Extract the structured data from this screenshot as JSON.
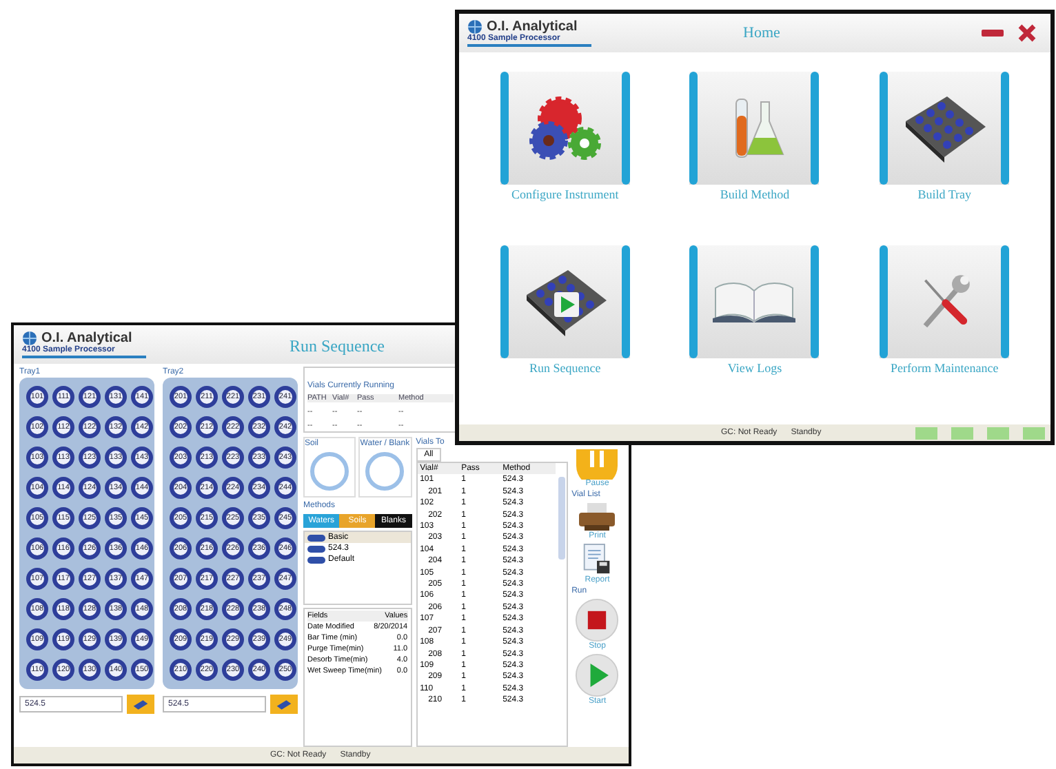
{
  "run_window": {
    "logo": "O.I. Analytical",
    "subtitle": "4100 Sample Processor",
    "title": "Run Sequence",
    "trays": [
      {
        "label": "Tray1",
        "method": "524.5",
        "vials": [
          "101",
          "111",
          "121",
          "131",
          "141",
          "102",
          "112",
          "122",
          "132",
          "142",
          "103",
          "113",
          "123",
          "133",
          "143",
          "104",
          "114",
          "124",
          "134",
          "144",
          "105",
          "115",
          "125",
          "135",
          "145",
          "106",
          "116",
          "126",
          "136",
          "146",
          "107",
          "117",
          "127",
          "137",
          "147",
          "108",
          "118",
          "128",
          "138",
          "148",
          "109",
          "119",
          "129",
          "139",
          "149",
          "110",
          "120",
          "130",
          "140",
          "150"
        ]
      },
      {
        "label": "Tray2",
        "method": "524.5",
        "vials": [
          "201",
          "211",
          "221",
          "231",
          "241",
          "202",
          "212",
          "222",
          "232",
          "242",
          "203",
          "213",
          "223",
          "233",
          "243",
          "204",
          "214",
          "224",
          "234",
          "244",
          "205",
          "215",
          "225",
          "235",
          "245",
          "206",
          "216",
          "226",
          "236",
          "246",
          "207",
          "217",
          "227",
          "237",
          "247",
          "208",
          "218",
          "228",
          "238",
          "248",
          "209",
          "219",
          "229",
          "239",
          "249",
          "210",
          "220",
          "230",
          "240",
          "250"
        ]
      }
    ],
    "running": {
      "title": "Vials Currently Running",
      "columns": [
        "PATH",
        "Vial#",
        "Pass",
        "Method"
      ],
      "rows": [
        [
          "--",
          "--",
          "--",
          "--"
        ],
        [
          "--",
          "--",
          "--",
          "--"
        ]
      ]
    },
    "soil": "Soil",
    "water": "Water / Blank",
    "methods": {
      "title": "Methods",
      "tabs": [
        {
          "label": "Waters",
          "color": "#29a3d8"
        },
        {
          "label": "Soils",
          "color": "#e8a42a"
        },
        {
          "label": "Blanks",
          "color": "#111111"
        }
      ],
      "items": [
        {
          "label": "Basic",
          "selected": true
        },
        {
          "label": "524.3",
          "selected": false
        },
        {
          "label": "Default",
          "selected": false
        }
      ]
    },
    "fields": {
      "columns": [
        "Fields",
        "Values"
      ],
      "rows": [
        [
          "Date Modified",
          "8/20/2014"
        ],
        [
          "Bar Time (min)",
          "0.0"
        ],
        [
          "Purge Time(min)",
          "11.0"
        ],
        [
          "Desorb Time(min)",
          "4.0"
        ],
        [
          "Wet Sweep Time(min)",
          "0.0"
        ]
      ]
    },
    "vials_to": {
      "label": "Vials To",
      "tab": "All",
      "columns": [
        "Vial#",
        "Pass",
        "Method"
      ],
      "rows": [
        [
          "101",
          "1",
          "524.3"
        ],
        [
          "201",
          "1",
          "524.3"
        ],
        [
          "102",
          "1",
          "524.3"
        ],
        [
          "202",
          "1",
          "524.3"
        ],
        [
          "103",
          "1",
          "524.3"
        ],
        [
          "203",
          "1",
          "524.3"
        ],
        [
          "104",
          "1",
          "524.3"
        ],
        [
          "204",
          "1",
          "524.3"
        ],
        [
          "105",
          "1",
          "524.3"
        ],
        [
          "205",
          "1",
          "524.3"
        ],
        [
          "106",
          "1",
          "524.3"
        ],
        [
          "206",
          "1",
          "524.3"
        ],
        [
          "107",
          "1",
          "524.3"
        ],
        [
          "207",
          "1",
          "524.3"
        ],
        [
          "108",
          "1",
          "524.3"
        ],
        [
          "208",
          "1",
          "524.3"
        ],
        [
          "109",
          "1",
          "524.3"
        ],
        [
          "209",
          "1",
          "524.3"
        ],
        [
          "110",
          "1",
          "524.3"
        ],
        [
          "210",
          "1",
          "524.3"
        ]
      ]
    },
    "controls": [
      {
        "kind": "pause",
        "label": "Pause"
      },
      {
        "kind": "heading",
        "label": "Vial List"
      },
      {
        "kind": "print",
        "label": "Print"
      },
      {
        "kind": "report",
        "label": "Report"
      },
      {
        "kind": "heading",
        "label": "Run"
      },
      {
        "kind": "stop",
        "label": "Stop"
      },
      {
        "kind": "start",
        "label": "Start"
      }
    ],
    "status_bar": [
      "GC: Not Ready",
      "Standby"
    ]
  },
  "home_window": {
    "logo": "O.I. Analytical",
    "subtitle": "4100 Sample Processor",
    "title": "Home",
    "tiles": [
      {
        "kind": "gears",
        "label": "Configure Instrument"
      },
      {
        "kind": "flask",
        "label": "Build Method"
      },
      {
        "kind": "tray",
        "label": "Build Tray"
      },
      {
        "kind": "run",
        "label": "Run Sequence"
      },
      {
        "kind": "book",
        "label": "View Logs"
      },
      {
        "kind": "tools",
        "label": "Perform Maintenance"
      }
    ],
    "status_bar": [
      "GC: Not Ready",
      "Standby"
    ]
  }
}
